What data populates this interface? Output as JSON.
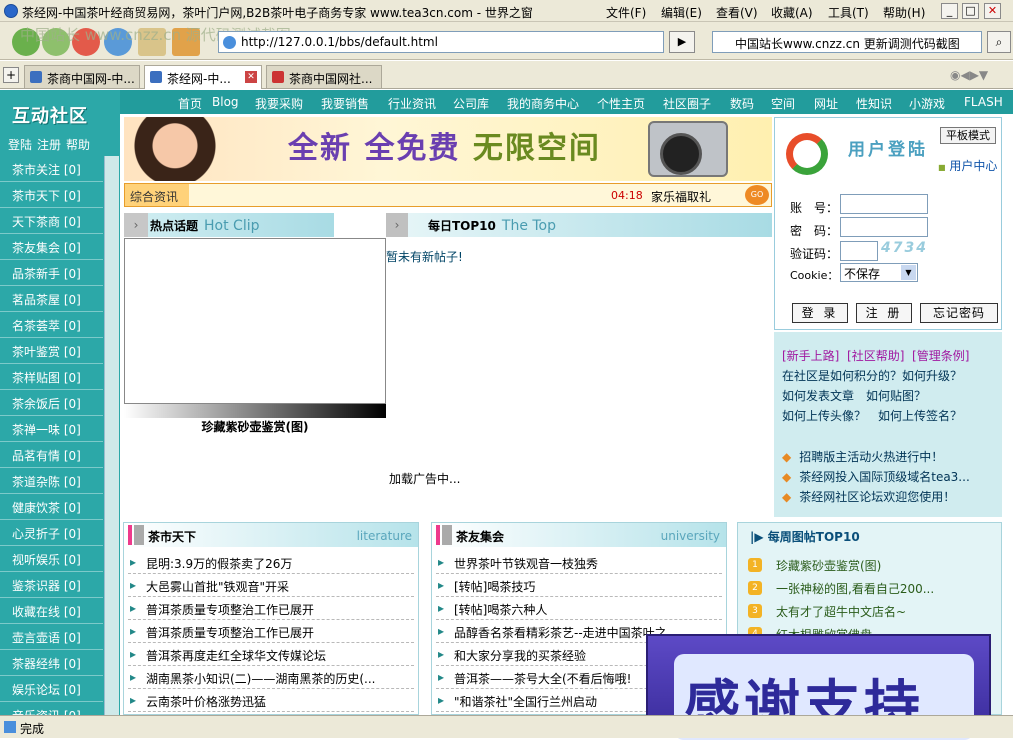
{
  "window": {
    "title": "茶经网-中国茶叶经商贸易网，茶叶门户网,B2B茶叶电子商务专家 www.tea3cn.com - 世界之窗",
    "menus": [
      "文件(F)",
      "编辑(E)",
      "查看(V)",
      "收藏(A)",
      "工具(T)",
      "帮助(H)"
    ]
  },
  "toolbar": {
    "address": "http://127.0.0.1/bbs/default.html",
    "search_value": "中国站长www.cnzz.cn 更新调测代码截图",
    "watermark": "中国站长 www.cnzz.cn 源代码测试截图"
  },
  "tabs": [
    {
      "label": "茶商中国网-中..."
    },
    {
      "label": "茶经网-中..."
    },
    {
      "label": "茶商中国网社..."
    }
  ],
  "sidebar": {
    "logo": "互动社区",
    "links": [
      "登陆",
      "注册",
      "帮助"
    ],
    "items": [
      "茶市关注 [0]",
      "茶市天下 [0]",
      "天下茶商 [0]",
      "茶友集会 [0]",
      "品茶新手 [0]",
      "茗品茶屋 [0]",
      "名茶荟萃 [0]",
      "茶叶鉴赏 [0]",
      "茶样贴图 [0]",
      "茶余饭后 [0]",
      "茶禅一味 [0]",
      "品茗有情 [0]",
      "茶道杂陈 [0]",
      "健康饮茶 [0]",
      "心灵折子 [0]",
      "视听娱乐 [0]",
      "鉴茶识器 [0]",
      "收藏在线 [0]",
      "壶言壶语 [0]",
      "茶器经纬 [0]",
      "娱乐论坛 [0]",
      "音乐资讯 [0]"
    ]
  },
  "nav": [
    "首页",
    "Blog",
    "我要采购",
    "我要销售",
    "行业资讯",
    "公司库",
    "我的商务中心",
    "个性主页",
    "社区圈子",
    "数码",
    "空间",
    "网址",
    "性知识",
    "小游戏",
    "FLASH"
  ],
  "banner": {
    "text1": "全新",
    "text2": "全免费",
    "text3": "无限空间"
  },
  "ticker": {
    "label": "综合资讯",
    "time": "04:18",
    "text": "家乐福取礼",
    "go": "GO"
  },
  "hot": {
    "title": "热点话题",
    "en": "Hot Clip",
    "caption": "珍藏紫砂壶鉴赏(图)"
  },
  "top": {
    "title": "每日TOP10",
    "en": "The Top",
    "empty": "暂未有新帖子!"
  },
  "ad": "加载广告中...",
  "login": {
    "title": "用户登陆",
    "flat": "平板模式",
    "ucenter": "用户中心",
    "account": "账　号：",
    "password": "密　码：",
    "captcha": "验证码：",
    "cookie": "Cookie：",
    "cookie_value": "不保存",
    "captcha_img": "4734",
    "login": "登 录",
    "register": "注 册",
    "forgot": "忘记密码"
  },
  "help": {
    "links": [
      "[新手上路]",
      "[社区帮助]",
      "[管理条例]"
    ],
    "q1": "在社区是如何积分的？如何升级？",
    "q2": "如何发表文章　如何贴图？",
    "q3": "如何上传头像？　如何上传签名？",
    "news": [
      "招聘版主活动火热进行中！",
      "茶经网投入国际顶级域名tea3...",
      "茶经网社区论坛欢迎您使用！"
    ]
  },
  "box1": {
    "title": "茶市天下",
    "en": "literature",
    "rows": [
      "昆明:3.9万的假茶卖了26万",
      "大邑雾山首批\"铁观音\"开采",
      "普洱茶质量专项整治工作已展开",
      "普洱茶质量专项整治工作已展开",
      "普洱茶再度走红全球华文传媒论坛",
      "湖南黑茶小知识(二)——湖南黑茶的历史(...",
      "云南茶叶价格涨势迅猛"
    ]
  },
  "box2": {
    "title": "茶友集会",
    "en": "university",
    "rows": [
      "世界茶叶节铁观音一枝独秀",
      "[转帖]喝茶技巧",
      "[转帖]喝茶六种人",
      "品醇香名茶看精彩茶艺--走进中国茶叶之",
      "和大家分享我的买茶经验",
      "普洱茶——茶号大全(不看后悔哦!",
      "\"和谐茶社\"全国行兰州启动"
    ]
  },
  "top10": {
    "title": "每周图帖TOP10",
    "rows": [
      "珍藏紫砂壶鉴赏(图)",
      "一张神秘的图,看看自己200...",
      "太有才了超牛中文店名~",
      "红木根雕欣赏佛盘"
    ]
  },
  "overlay": {
    "text": "感谢支持"
  },
  "status": {
    "text": "完成"
  }
}
